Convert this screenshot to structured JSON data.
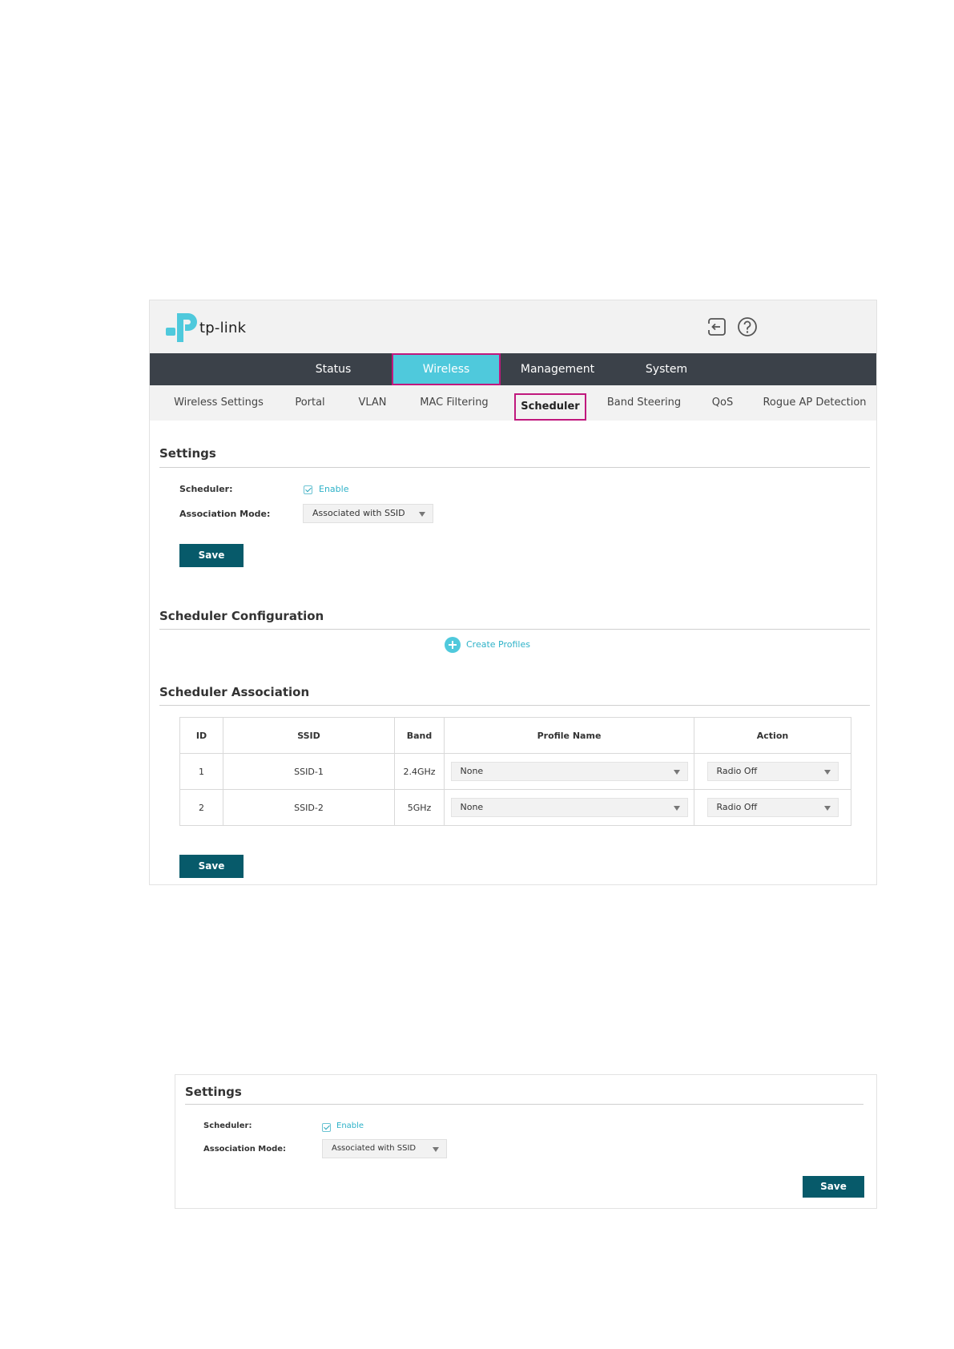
{
  "brand": {
    "logo_text": "tp-link",
    "accent": "#4fc9dc",
    "dark_button": "#075a6a",
    "highlight": "#c0187d"
  },
  "header_icons": [
    "logout-icon",
    "help-icon"
  ],
  "main_nav": [
    {
      "label": "Status",
      "active": false
    },
    {
      "label": "Wireless",
      "active": true
    },
    {
      "label": "Management",
      "active": false
    },
    {
      "label": "System",
      "active": false
    }
  ],
  "sub_nav": [
    {
      "label": "Wireless Settings",
      "active": false
    },
    {
      "label": "Portal",
      "active": false
    },
    {
      "label": "VLAN",
      "active": false
    },
    {
      "label": "MAC Filtering",
      "active": false
    },
    {
      "label": "Scheduler",
      "active": true
    },
    {
      "label": "Band Steering",
      "active": false
    },
    {
      "label": "QoS",
      "active": false
    },
    {
      "label": "Rogue AP Detection",
      "active": false
    }
  ],
  "settings": {
    "title": "Settings",
    "scheduler_label": "Scheduler:",
    "enable_label": "Enable",
    "enable_checked": true,
    "association_mode_label": "Association Mode:",
    "association_mode_value": "Associated with SSID",
    "save_label": "Save"
  },
  "scheduler_configuration": {
    "title": "Scheduler Configuration",
    "create_profiles_label": "Create Profiles"
  },
  "scheduler_association": {
    "title": "Scheduler Association",
    "columns": [
      "ID",
      "SSID",
      "Band",
      "Profile Name",
      "Action"
    ],
    "rows": [
      {
        "id": "1",
        "ssid": "SSID-1",
        "band": "2.4GHz",
        "profile": "None",
        "action": "Radio Off"
      },
      {
        "id": "2",
        "ssid": "SSID-2",
        "band": "5GHz",
        "profile": "None",
        "action": "Radio Off"
      }
    ],
    "save_label": "Save"
  },
  "settings_panel_2": {
    "title": "Settings",
    "scheduler_label": "Scheduler:",
    "enable_label": "Enable",
    "enable_checked": true,
    "association_mode_label": "Association Mode:",
    "association_mode_value": "Associated with SSID",
    "save_label": "Save"
  }
}
